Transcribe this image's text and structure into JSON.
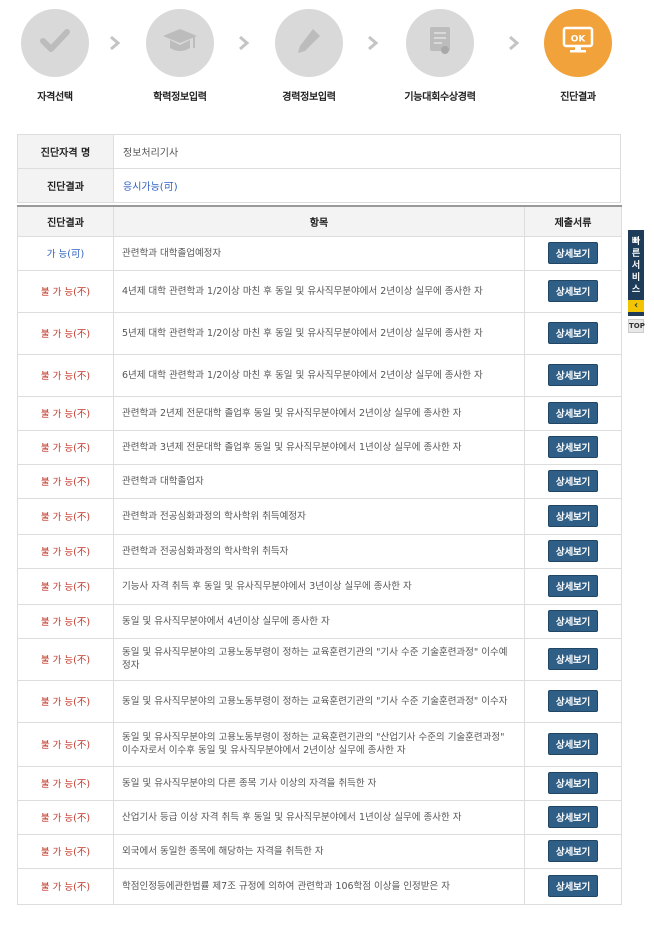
{
  "steps": [
    {
      "label": "자격선택",
      "icon": "check-icon"
    },
    {
      "label": "학력정보입력",
      "icon": "graduation-cap-icon"
    },
    {
      "label": "경력정보입력",
      "icon": "pencil-icon"
    },
    {
      "label": "기능대회수상경력",
      "icon": "certificate-icon"
    },
    {
      "label": "진단결과",
      "icon": "monitor-ok-icon",
      "icon_text": "OK"
    }
  ],
  "summary": {
    "name_label": "진단자격 명",
    "name_value": "정보처리기사",
    "result_label": "진단결과",
    "result_value": "응시가능(可)"
  },
  "table": {
    "headers": [
      "진단결과",
      "항목",
      "제출서류"
    ],
    "button_label": "상세보기",
    "rows": [
      {
        "result": "가 능(可)",
        "ok": true,
        "item": "관련학과 대학졸업예정자"
      },
      {
        "result": "불 가 능(不)",
        "ok": false,
        "item": "4년제 대학 관련학과 1/2이상 마친 후 동일 및 유사직무분야에서 2년이상 실무에 종사한 자"
      },
      {
        "result": "불 가 능(不)",
        "ok": false,
        "item": "5년제 대학 관련학과 1/2이상 마친 후 동일 및 유사직무분야에서 2년이상 실무에 종사한 자"
      },
      {
        "result": "불 가 능(不)",
        "ok": false,
        "item": "6년제 대학 관련학과 1/2이상 마친 후 동일 및 유사직무분야에서 2년이상 실무에 종사한 자"
      },
      {
        "result": "불 가 능(不)",
        "ok": false,
        "item": "관련학과 2년제 전문대학 졸업후 동일 및 유사직무분야에서 2년이상 실무에 종사한 자"
      },
      {
        "result": "불 가 능(不)",
        "ok": false,
        "item": "관련학과 3년제 전문대학 졸업후 동일 및 유사직무분야에서 1년이상 실무에 종사한 자"
      },
      {
        "result": "불 가 능(不)",
        "ok": false,
        "item": "관련학과 대학졸업자"
      },
      {
        "result": "불 가 능(不)",
        "ok": false,
        "item": "관련학과 전공심화과정의 학사학위 취득예정자"
      },
      {
        "result": "불 가 능(不)",
        "ok": false,
        "item": "관련학과 전공심화과정의 학사학위 취득자"
      },
      {
        "result": "불 가 능(不)",
        "ok": false,
        "item": "기능사 자격 취득 후 동일 및 유사직무분야에서 3년이상 실무에 종사한 자"
      },
      {
        "result": "불 가 능(不)",
        "ok": false,
        "item": "동일 및 유사직무분야에서 4년이상 실무에 종사한 자"
      },
      {
        "result": "불 가 능(不)",
        "ok": false,
        "item": "동일 및 유사직무분야의 고용노동부령이 정하는 교육훈련기관의 \"기사 수준 기술훈련과정\" 이수예정자"
      },
      {
        "result": "불 가 능(不)",
        "ok": false,
        "item": "동일 및 유사직무분야의 고용노동부령이 정하는 교육훈련기관의 \"기사 수준 기술훈련과정\" 이수자"
      },
      {
        "result": "불 가 능(不)",
        "ok": false,
        "item": "동일 및 유사직무분야의 고용노동부령이 정하는 교육훈련기관의 \"산업기사 수준의 기술훈련과정\" 이수자로서 이수후 동일 및 유사직무분야에서 2년이상 실무에 종사한 자"
      },
      {
        "result": "불 가 능(不)",
        "ok": false,
        "item": "동일 및 유사직무분야의 다른 종목 기사 이상의 자격을 취득한 자"
      },
      {
        "result": "불 가 능(不)",
        "ok": false,
        "item": "산업기사 등급 이상 자격 취득 후 동일 및 유사직무분야에서 1년이상 실무에 종사한 자"
      },
      {
        "result": "불 가 능(不)",
        "ok": false,
        "item": "외국에서 동일한 종목에 해당하는 자격을 취득한 자"
      },
      {
        "result": "불 가 능(不)",
        "ok": false,
        "item": "학점인정등에관한법률 제7조 규정에 의하여 관련학과 106학점 이상을 인정받은 자"
      }
    ]
  },
  "quick_service": {
    "label": "빠른서비스",
    "top_label": "TOP"
  },
  "colors": {
    "active_step": "#f2a23a",
    "inactive_step": "#d9d9d9",
    "ok": "#2d5fc2",
    "no": "#c0392b",
    "button": "#2f5f86"
  }
}
